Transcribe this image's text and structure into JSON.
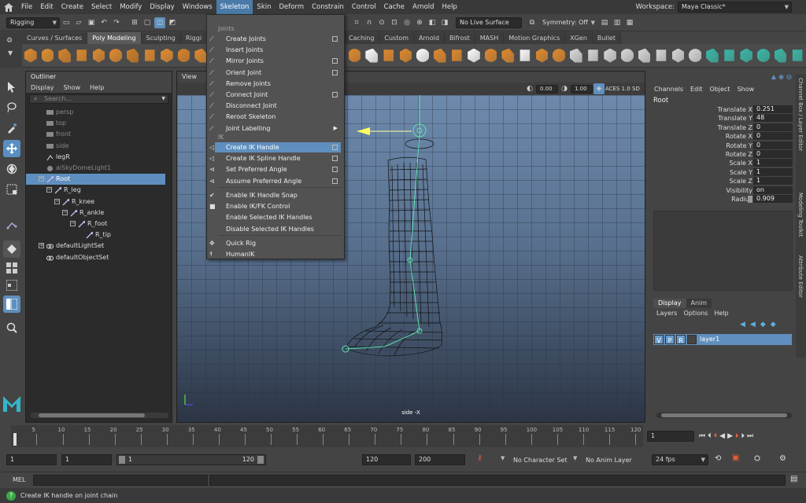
{
  "menubar": {
    "items": [
      "File",
      "Edit",
      "Create",
      "Select",
      "Modify",
      "Display",
      "Windows",
      "Skeleton",
      "Skin",
      "Deform",
      "Constrain",
      "Control",
      "Cache",
      "Arnold",
      "Help"
    ],
    "active_index": 7,
    "workspace_label": "Workspace:",
    "workspace_value": "Maya Classic*"
  },
  "statusline": {
    "menuset": "Rigging",
    "live_surface": "No Live Surface",
    "symmetry": "Symmetry: Off"
  },
  "shelf": {
    "tabs": [
      "Curves / Surfaces",
      "Poly Modeling",
      "Sculpting",
      "Riggi",
      "Caching",
      "Custom",
      "Arnold",
      "Bifrost",
      "MASH",
      "Motion Graphics",
      "XGen",
      "Bullet"
    ],
    "active_index": 1
  },
  "skeleton_menu": {
    "section_joints": "Joints",
    "joints": [
      {
        "label": "Create Joints",
        "option": true
      },
      {
        "label": "Insert Joints",
        "option": false
      },
      {
        "label": "Mirror Joints",
        "option": true
      },
      {
        "label": "Orient Joint",
        "option": true
      },
      {
        "label": "Remove Joints",
        "option": false
      },
      {
        "label": "Connect Joint",
        "option": true
      },
      {
        "label": "Disconnect Joint",
        "option": false
      },
      {
        "label": "Reroot Skeleton",
        "option": false
      },
      {
        "label": "Joint Labelling",
        "submenu": true
      }
    ],
    "section_ik": "IK",
    "ik": [
      {
        "label": "Create IK Handle",
        "option": true,
        "highlighted": true
      },
      {
        "label": "Create IK Spline Handle",
        "option": true
      },
      {
        "label": "Set Preferred Angle",
        "option": true
      },
      {
        "label": "Assume Preferred Angle",
        "option": true
      }
    ],
    "toggles": [
      {
        "label": "Enable IK Handle Snap",
        "checked": true
      },
      {
        "label": "Enable IK/FK Control",
        "checked": false
      },
      {
        "label": "Enable Selected IK Handles"
      },
      {
        "label": "Disable Selected IK Handles"
      }
    ],
    "rig": [
      {
        "label": "Quick Rig"
      },
      {
        "label": "HumanIK"
      }
    ]
  },
  "outliner": {
    "title": "Outliner",
    "menu": [
      "Display",
      "Show",
      "Help"
    ],
    "search_placeholder": "Search...",
    "items": [
      {
        "label": "persp",
        "depth": 0,
        "dim": true,
        "icon": "camera-icon"
      },
      {
        "label": "top",
        "depth": 0,
        "dim": true,
        "icon": "camera-icon"
      },
      {
        "label": "front",
        "depth": 0,
        "dim": true,
        "icon": "camera-icon"
      },
      {
        "label": "side",
        "depth": 0,
        "dim": true,
        "icon": "camera-icon"
      },
      {
        "label": "legR",
        "depth": 0,
        "dim": false,
        "icon": "ik-handle-icon"
      },
      {
        "label": "aiSkyDomeLight1",
        "depth": 0,
        "dim": true,
        "icon": "light-icon"
      },
      {
        "label": "Root",
        "depth": 0,
        "dim": false,
        "selected": true,
        "icon": "joint-icon",
        "expander": "minus"
      },
      {
        "label": "R_leg",
        "depth": 1,
        "dim": false,
        "icon": "joint-icon",
        "expander": "minus"
      },
      {
        "label": "R_knee",
        "depth": 2,
        "dim": false,
        "icon": "joint-icon",
        "expander": "minus"
      },
      {
        "label": "R_ankle",
        "depth": 3,
        "dim": false,
        "icon": "joint-icon",
        "expander": "minus"
      },
      {
        "label": "R_foot",
        "depth": 4,
        "dim": false,
        "icon": "joint-icon",
        "expander": "minus"
      },
      {
        "label": "R_tip",
        "depth": 5,
        "dim": false,
        "icon": "joint-icon"
      },
      {
        "label": "defaultLightSet",
        "depth": 0,
        "dim": false,
        "icon": "set-icon",
        "expander": "plus"
      },
      {
        "label": "defaultObjectSet",
        "depth": 0,
        "dim": false,
        "icon": "set-icon"
      }
    ]
  },
  "viewport": {
    "menu_first": "View",
    "field_a": "0.00",
    "field_b": "1.00",
    "colorspace": "ACES 1.0 SD",
    "camera_label": "side -X"
  },
  "channelbox": {
    "menu": [
      "Channels",
      "Edit",
      "Object",
      "Show"
    ],
    "object": "Root",
    "attrs": [
      {
        "name": "Translate X",
        "value": "0.251"
      },
      {
        "name": "Translate Y",
        "value": "48"
      },
      {
        "name": "Translate Z",
        "value": "0"
      },
      {
        "name": "Rotate X",
        "value": "0"
      },
      {
        "name": "Rotate Y",
        "value": "0"
      },
      {
        "name": "Rotate Z",
        "value": "0"
      },
      {
        "name": "Scale X",
        "value": "1"
      },
      {
        "name": "Scale Y",
        "value": "1"
      },
      {
        "name": "Scale Z",
        "value": "1"
      },
      {
        "name": "Visibility",
        "value": "on"
      },
      {
        "name": "Radius",
        "value": "0.909"
      }
    ],
    "side_tabs": [
      "Channel Box / Layer Editor",
      "Modeling Toolkit",
      "Attribute Editor"
    ]
  },
  "layers": {
    "tabs": [
      "Display",
      "Anim"
    ],
    "menu": [
      "Layers",
      "Options",
      "Help"
    ],
    "layer_v": "V",
    "layer_p": "P",
    "layer_r": "R",
    "layer_name": "layer1"
  },
  "timeslider": {
    "ticks": [
      "5",
      "10",
      "15",
      "20",
      "25",
      "30",
      "35",
      "40",
      "45",
      "50",
      "55",
      "60",
      "65",
      "70",
      "75",
      "80",
      "85",
      "90",
      "95",
      "100",
      "105",
      "110",
      "115",
      "120"
    ],
    "current_frame": "1"
  },
  "range": {
    "start": "1",
    "anim_start": "1",
    "range_start": "1",
    "range_end": "120",
    "anim_end": "120",
    "end": "200",
    "character_set": "No Character Set",
    "anim_layer": "No Anim Layer",
    "fps": "24 fps"
  },
  "command": {
    "label": "MEL",
    "help": "Create IK handle on joint chain"
  },
  "colors": {
    "highlight": "#5f8fbe",
    "menu_active": "#4a7ba8",
    "shelf_orange": "#e08a2c"
  }
}
